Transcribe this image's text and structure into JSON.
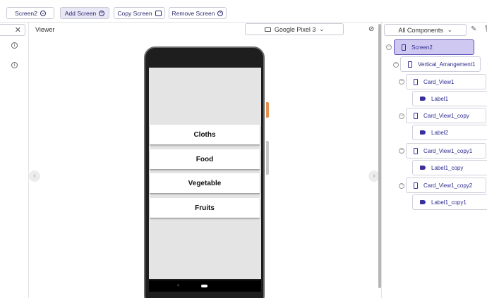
{
  "toolbar": {
    "screen_select": "Screen2",
    "add_screen": "Add Screen",
    "copy_screen": "Copy Screen",
    "remove_screen": "Remove Screen"
  },
  "viewer": {
    "title": "Viewer",
    "device": "Google Pixel 3",
    "cards": [
      "Cloths",
      "Food",
      "Vegetable",
      "Fruits"
    ]
  },
  "components": {
    "filter": "All Components",
    "tree": [
      {
        "label": "Screen2",
        "icon": "phone-icon"
      },
      {
        "label": "Vertical_Arrangement1",
        "icon": "vertical-arrangement-icon"
      },
      {
        "label": "Card_View1",
        "icon": "card-view-icon"
      },
      {
        "label": "Label1",
        "icon": "label-icon"
      },
      {
        "label": "Card_View1_copy",
        "icon": "card-view-icon"
      },
      {
        "label": "Label2",
        "icon": "label-icon"
      },
      {
        "label": "Card_View1_copy1",
        "icon": "card-view-icon"
      },
      {
        "label": "Label1_copy",
        "icon": "label-icon"
      },
      {
        "label": "Card_View1_copy2",
        "icon": "card-view-icon"
      },
      {
        "label": "Label1_copy1",
        "icon": "label-icon"
      }
    ]
  },
  "colors": {
    "accent": "#2c2a8e",
    "selected_bg": "#cfc9f2",
    "side_button": "#e5904f"
  }
}
